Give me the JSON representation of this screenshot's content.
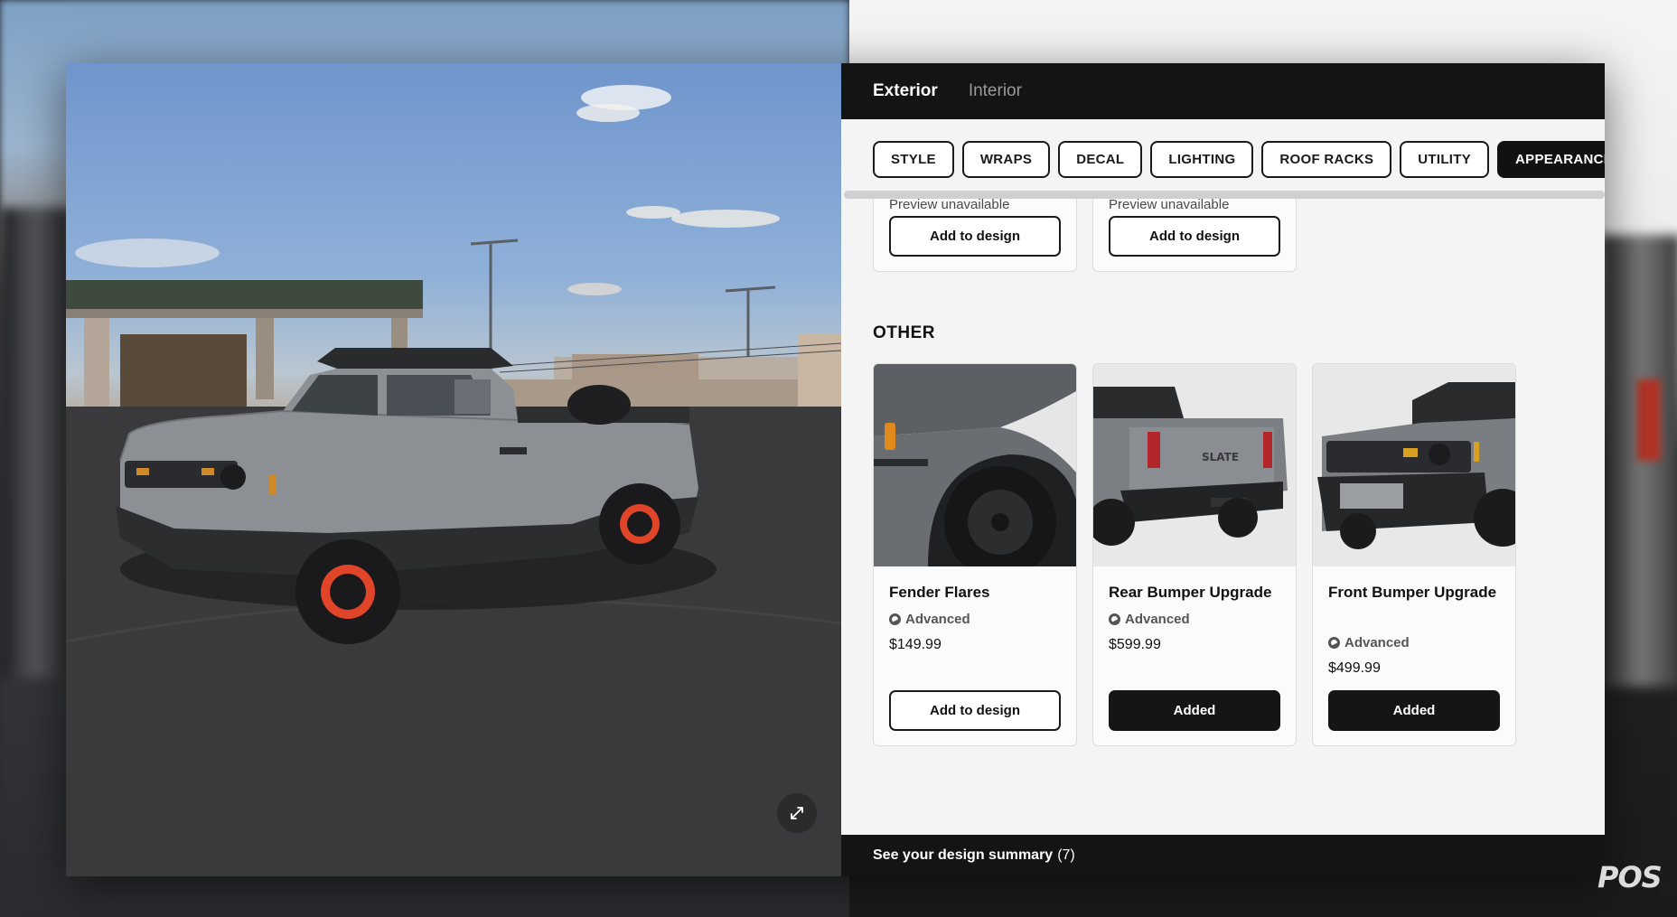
{
  "header": {
    "tabs": [
      {
        "label": "Exterior",
        "active": true
      },
      {
        "label": "Interior",
        "active": false
      }
    ]
  },
  "categories": [
    {
      "label": "STYLE"
    },
    {
      "label": "WRAPS"
    },
    {
      "label": "DECAL"
    },
    {
      "label": "LIGHTING"
    },
    {
      "label": "ROOF RACKS"
    },
    {
      "label": "UTILITY"
    },
    {
      "label": "APPEARANCE",
      "active": true
    }
  ],
  "previous_row": [
    {
      "preview_text": "Preview unavailable",
      "button_label": "Add to design"
    },
    {
      "preview_text": "Preview unavailable",
      "button_label": "Add to design"
    }
  ],
  "other_section": {
    "title": "OTHER",
    "items": [
      {
        "name": "Fender Flares",
        "tier": "Advanced",
        "price": "$149.99",
        "button_label": "Add to design",
        "added": false
      },
      {
        "name": "Rear Bumper Upgrade",
        "tier": "Advanced",
        "price": "$599.99",
        "button_label": "Added",
        "added": true
      },
      {
        "name": "Front Bumper Upgrade",
        "tier": "Advanced",
        "price": "$499.99",
        "button_label": "Added",
        "added": true
      }
    ]
  },
  "summary": {
    "label": "See your design summary",
    "count": "(7)"
  },
  "vehicle_badge": "SLATE",
  "watermark": "POS",
  "icons": {
    "expand": "expand-arrows-icon",
    "tier": "advanced-tier-icon"
  },
  "colors": {
    "accent": "#141414",
    "wheel": "#e0452a",
    "panel_bg": "#f4f4f4"
  }
}
